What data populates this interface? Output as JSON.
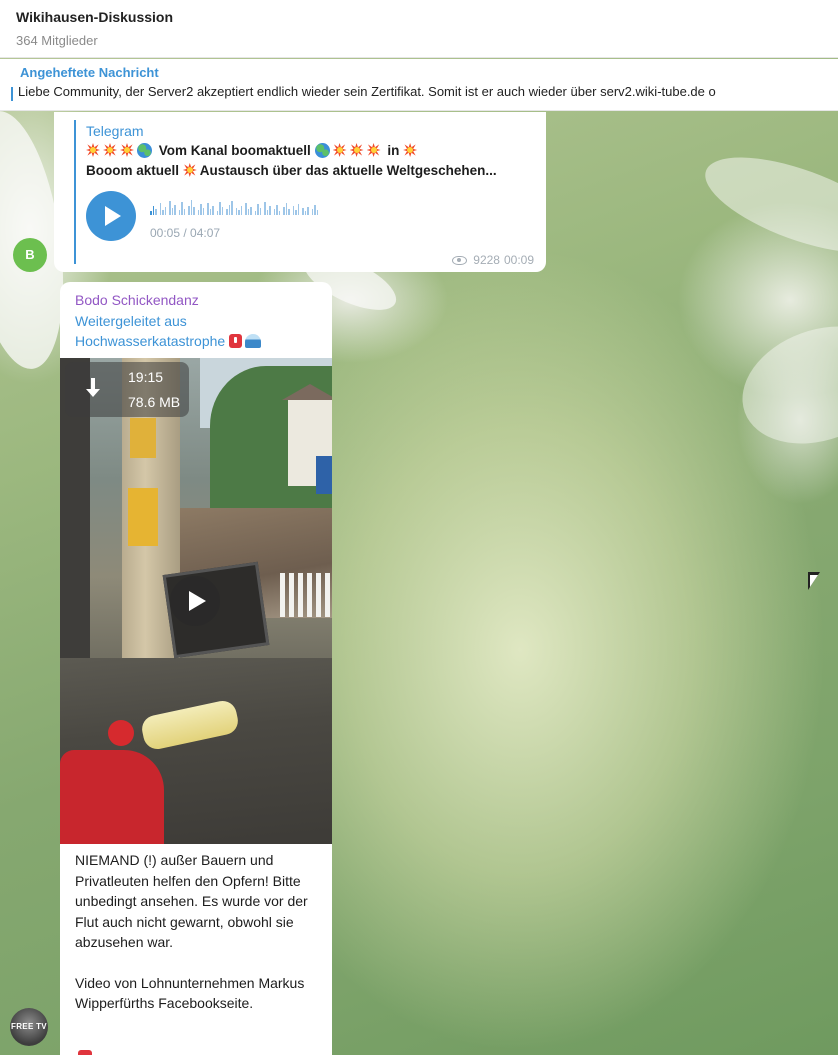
{
  "header": {
    "title": "Wikihausen-Diskussion",
    "members": "364 Mitglieder"
  },
  "pinned": {
    "label": "Angeheftete Nachricht",
    "text": "Liebe Community,  der Server2 akzeptiert endlich wieder sein Zertifikat.  Somit ist er auch wieder über serv2.wiki-tube.de o"
  },
  "message1": {
    "forwarded_from": "Telegram",
    "line1_text1": "Vom Kanal boomaktuell",
    "line1_text2": "in",
    "line2_text1": "Booom aktuell",
    "line2_text2": "Austausch über das aktuelle Weltgeschehen...",
    "audio_duration": "00:05 / 04:07",
    "views": "9228",
    "time": "00:09",
    "avatar_letter": "B",
    "icons": [
      "boom-emoji",
      "globe-emoji",
      "eye-icon",
      "play-icon"
    ]
  },
  "message2": {
    "author": "Bodo Schickendanz",
    "forwarded_label": "Weitergeleitet aus",
    "forwarded_channel": "Hochwasserkatastrophe",
    "video_duration": "19:15",
    "video_size": "78.6 MB",
    "caption_p1": "NIEMAND (!) außer Bauern und Privatleuten helfen den Opfern! Bitte unbedingt ansehen. Es wurde vor der Flut auch nicht gewarnt, obwohl sie abzusehen war.",
    "caption_p2": "Video von Lohnunternehmen Markus Wipperfürths Facebookseite.",
    "icons": [
      "download-icon",
      "play-icon",
      "siren-emoji",
      "wave-emoji"
    ]
  },
  "sender_avatar2_text": "FREE TV",
  "colors": {
    "accent": "#3d93d6",
    "author": "#9257c4",
    "avatar_green": "#6cbf4f"
  }
}
